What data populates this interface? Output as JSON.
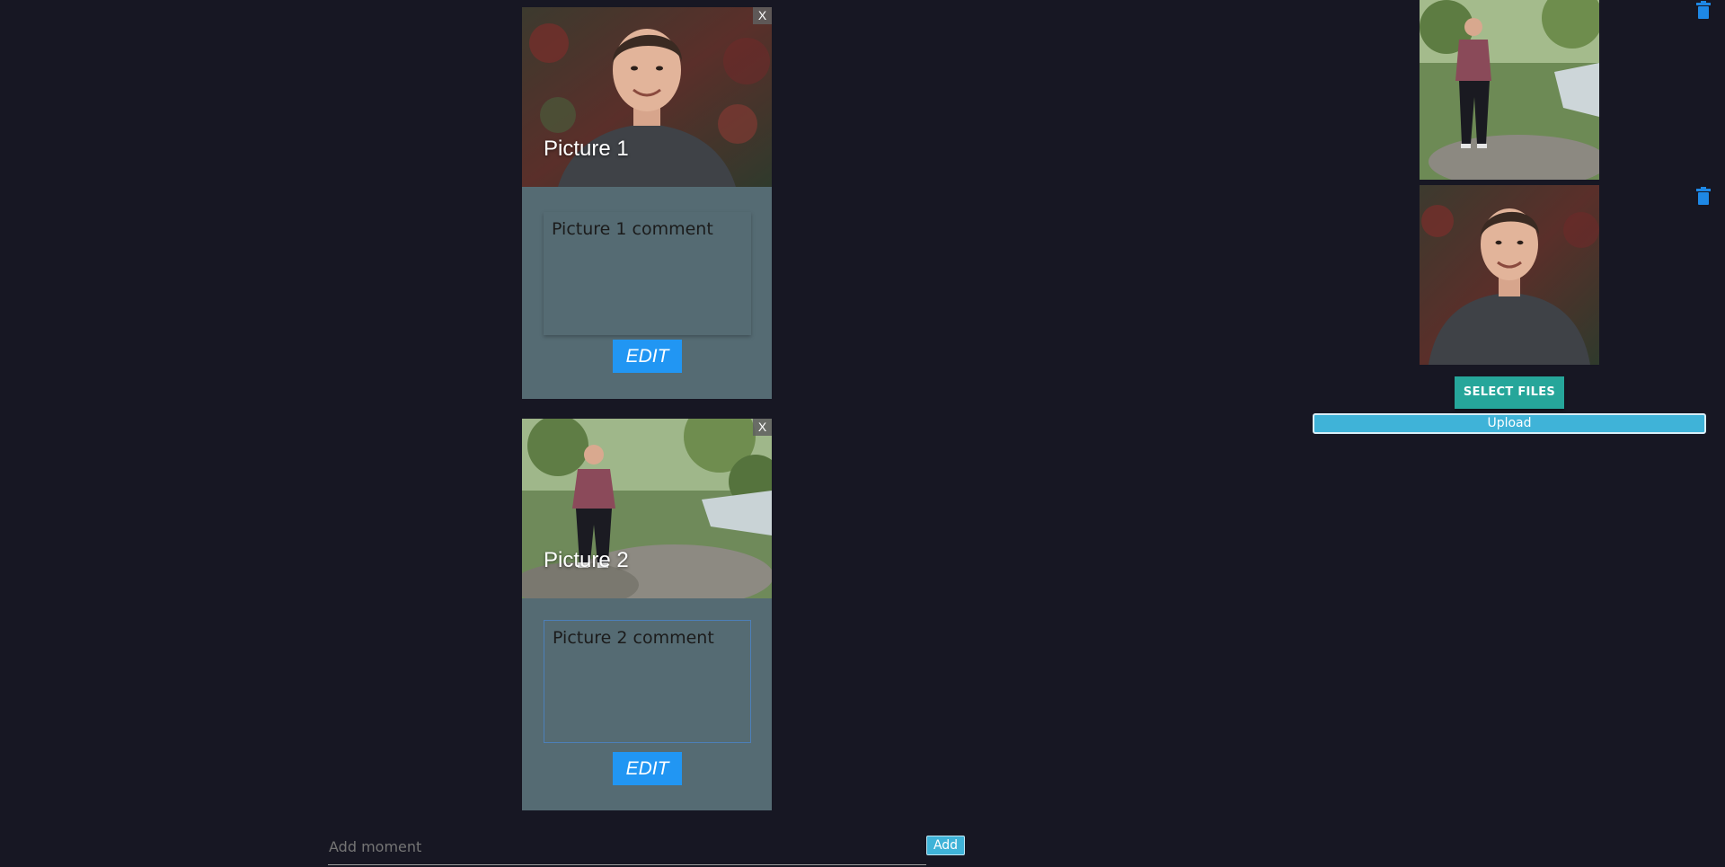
{
  "moments": [
    {
      "title": "Picture 1",
      "comment": "Picture 1 comment",
      "close_label": "X",
      "edit_label": "EDIT"
    },
    {
      "title": "Picture 2",
      "comment": "Picture 2 comment",
      "close_label": "X",
      "edit_label": "EDIT"
    }
  ],
  "add_moment": {
    "placeholder": "Add moment",
    "button_label": "Add"
  },
  "uploads": {
    "select_files_label": "SELECT FILES",
    "upload_label": "Upload",
    "delete_icon": "trash-icon"
  },
  "colors": {
    "background": "#171723",
    "card": "#556b73",
    "primary_blue": "#2196f3",
    "teal": "#26a69a",
    "light_blue": "#3fb3d8"
  }
}
